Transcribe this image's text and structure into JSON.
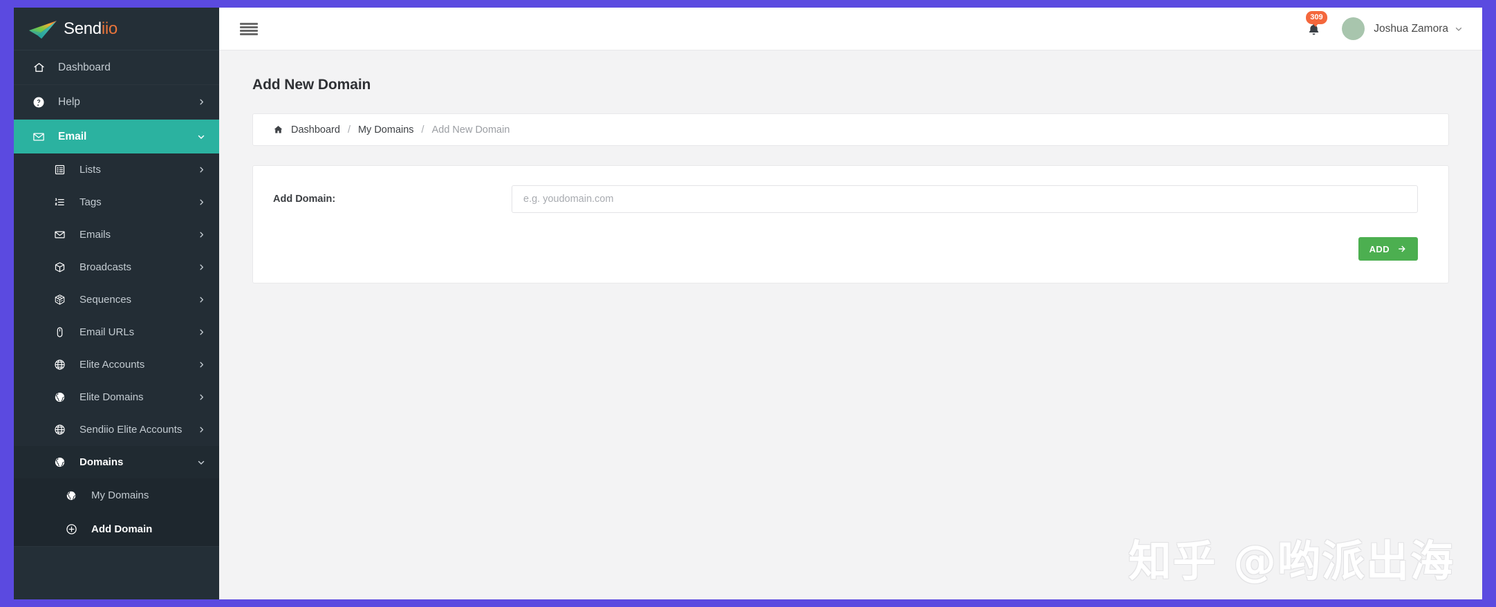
{
  "brand": {
    "name_white": "Send",
    "name_orange": "iio",
    "logo_icon": "paper-plane-icon"
  },
  "sidebar": {
    "items": [
      {
        "label": "Dashboard",
        "icon": "home-icon",
        "level": 1,
        "chevron": "none",
        "state": "default"
      },
      {
        "label": "Help",
        "icon": "question-circle-icon",
        "level": 1,
        "chevron": "right",
        "state": "default"
      },
      {
        "label": "Email",
        "icon": "envelope-icon",
        "level": 1,
        "chevron": "down",
        "state": "active"
      },
      {
        "label": "Lists",
        "icon": "list-box-icon",
        "level": 2,
        "chevron": "right",
        "state": "default"
      },
      {
        "label": "Tags",
        "icon": "ordered-list-icon",
        "level": 2,
        "chevron": "right",
        "state": "default"
      },
      {
        "label": "Emails",
        "icon": "envelope-open-icon",
        "level": 2,
        "chevron": "right",
        "state": "default"
      },
      {
        "label": "Broadcasts",
        "icon": "cube-icon",
        "level": 2,
        "chevron": "right",
        "state": "default"
      },
      {
        "label": "Sequences",
        "icon": "cubes-icon",
        "level": 2,
        "chevron": "right",
        "state": "default"
      },
      {
        "label": "Email URLs",
        "icon": "mouse-icon",
        "level": 2,
        "chevron": "right",
        "state": "default"
      },
      {
        "label": "Elite Accounts",
        "icon": "globe-grid-icon",
        "level": 2,
        "chevron": "right",
        "state": "default"
      },
      {
        "label": "Elite Domains",
        "icon": "globe-americas-icon",
        "level": 2,
        "chevron": "right",
        "state": "default"
      },
      {
        "label": "Sendiio Elite Accounts",
        "icon": "globe-grid-icon",
        "level": 2,
        "chevron": "right",
        "state": "default"
      },
      {
        "label": "Domains",
        "icon": "globe-americas-icon",
        "level": 2,
        "chevron": "down",
        "state": "expanded"
      },
      {
        "label": "My Domains",
        "icon": "globe-americas-icon",
        "level": 3,
        "chevron": "none",
        "state": "default"
      },
      {
        "label": "Add Domain",
        "icon": "plus-circle-icon",
        "level": 3,
        "chevron": "none",
        "state": "active"
      }
    ]
  },
  "topbar": {
    "menu_toggle_icon": "hamburger-icon",
    "notifications": {
      "icon": "bell-icon",
      "count": "309"
    },
    "user": {
      "name": "Joshua Zamora",
      "avatar_icon": "avatar",
      "caret_icon": "chevron-down-icon"
    }
  },
  "page": {
    "title": "Add New Domain",
    "breadcrumb": {
      "home_icon": "home-icon",
      "separator": "/",
      "items": [
        {
          "label": "Dashboard",
          "current": false
        },
        {
          "label": "My Domains",
          "current": false
        },
        {
          "label": "Add New Domain",
          "current": true
        }
      ]
    },
    "form": {
      "label": "Add Domain:",
      "input_value": "",
      "input_placeholder": "e.g. youdomain.com",
      "submit_label": "ADD",
      "submit_icon": "arrow-right-icon"
    }
  },
  "watermark": {
    "text": "知乎 @哟派出海"
  },
  "colors": {
    "frame_purple": "#5b4ae0",
    "sidebar_dark": "#242f37",
    "email_active_teal": "#2bb2a0",
    "add_button_green": "#4caf50",
    "badge_orange": "#f4673c",
    "brand_orange": "#e8743b"
  }
}
